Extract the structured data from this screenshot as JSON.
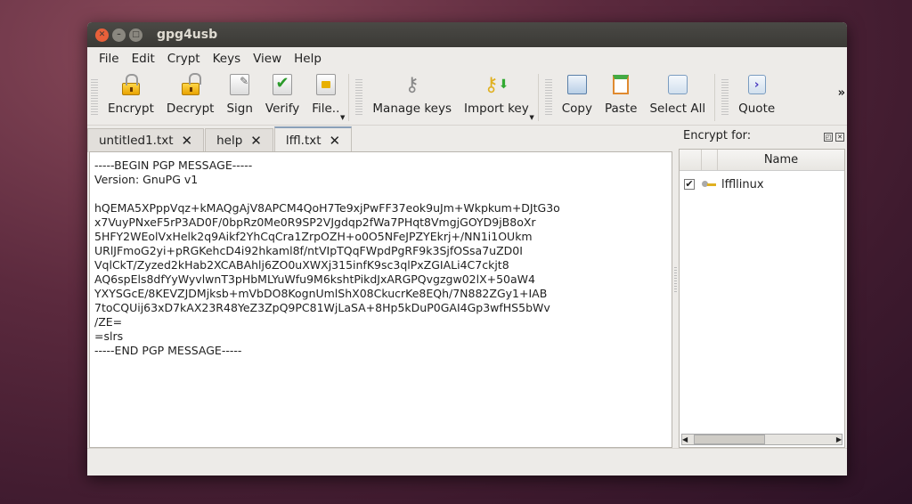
{
  "window": {
    "title": "gpg4usb"
  },
  "menu": [
    "File",
    "Edit",
    "Crypt",
    "Keys",
    "View",
    "Help"
  ],
  "toolbar": {
    "encrypt": "Encrypt",
    "decrypt": "Decrypt",
    "sign": "Sign",
    "verify": "Verify",
    "file": "File..",
    "manage_keys": "Manage keys",
    "import_key": "Import key",
    "copy": "Copy",
    "paste": "Paste",
    "select_all": "Select All",
    "quote": "Quote",
    "overflow": "»"
  },
  "tabs": [
    {
      "label": "untitled1.txt"
    },
    {
      "label": "help"
    },
    {
      "label": "lffl.txt",
      "active": true
    }
  ],
  "editor": {
    "content": "-----BEGIN PGP MESSAGE-----\nVersion: GnuPG v1\n\nhQEMA5XPppVqz+kMAQgAjV8APCM4QoH7Te9xjPwFF37eok9uJm+Wkpkum+DJtG3o\nx7VuyPNxeF5rP3AD0F/0bpRz0Me0R9SP2VJgdqp2fWa7PHqt8VmgjGOYD9jB8oXr\n5HFY2WEolVxHelk2q9Aikf2YhCqCra1ZrpOZH+o0O5NFeJPZYEkrj+/NN1i1OUkm\nURlJFmoG2yi+pRGKehcD4i92hkaml8f/ntVIpTQqFWpdPgRF9k3SjfOSsa7uZD0I\nVqlCkT/Zyzed2kHab2XCABAhlj6ZO0uXWXj315infK9sc3qlPxZGIALi4C7ckjt8\nAQ6spEls8dfYyWyvlwnT3pHbMLYuWfu9M6kshtPikdJxARGPQvgzgw02lX+50aW4\nYXYSGcE/8KEVZJDMjksb+mVbDO8KognUmlShX08CkucrKe8EQh/7N882ZGy1+IAB\n7toCQUij63xD7kAX23R48YeZ3ZpQ9PC81WjLaSA+8Hp5kDuP0GAI4Gp3wfHS5bWv\n/ZE=\n=slrs\n-----END PGP MESSAGE-----"
  },
  "dock": {
    "title": "Encrypt for:",
    "column": "Name",
    "keys": [
      {
        "name": "lffllinux",
        "checked": true
      }
    ]
  }
}
